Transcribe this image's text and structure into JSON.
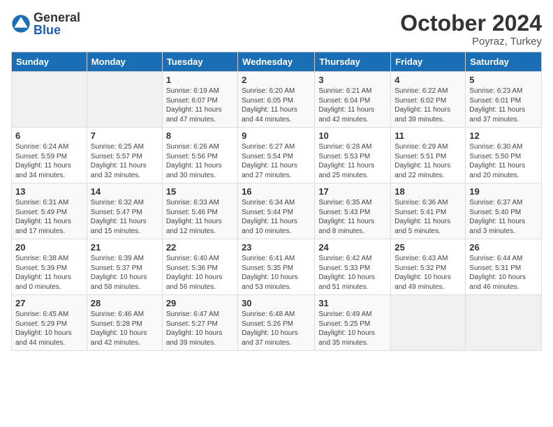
{
  "header": {
    "logo_general": "General",
    "logo_blue": "Blue",
    "month_title": "October 2024",
    "location": "Poyraz, Turkey"
  },
  "days_of_week": [
    "Sunday",
    "Monday",
    "Tuesday",
    "Wednesday",
    "Thursday",
    "Friday",
    "Saturday"
  ],
  "weeks": [
    [
      {
        "day": "",
        "info": ""
      },
      {
        "day": "",
        "info": ""
      },
      {
        "day": "1",
        "info": "Sunrise: 6:19 AM\nSunset: 6:07 PM\nDaylight: 11 hours and 47 minutes."
      },
      {
        "day": "2",
        "info": "Sunrise: 6:20 AM\nSunset: 6:05 PM\nDaylight: 11 hours and 44 minutes."
      },
      {
        "day": "3",
        "info": "Sunrise: 6:21 AM\nSunset: 6:04 PM\nDaylight: 11 hours and 42 minutes."
      },
      {
        "day": "4",
        "info": "Sunrise: 6:22 AM\nSunset: 6:02 PM\nDaylight: 11 hours and 39 minutes."
      },
      {
        "day": "5",
        "info": "Sunrise: 6:23 AM\nSunset: 6:01 PM\nDaylight: 11 hours and 37 minutes."
      }
    ],
    [
      {
        "day": "6",
        "info": "Sunrise: 6:24 AM\nSunset: 5:59 PM\nDaylight: 11 hours and 34 minutes."
      },
      {
        "day": "7",
        "info": "Sunrise: 6:25 AM\nSunset: 5:57 PM\nDaylight: 11 hours and 32 minutes."
      },
      {
        "day": "8",
        "info": "Sunrise: 6:26 AM\nSunset: 5:56 PM\nDaylight: 11 hours and 30 minutes."
      },
      {
        "day": "9",
        "info": "Sunrise: 6:27 AM\nSunset: 5:54 PM\nDaylight: 11 hours and 27 minutes."
      },
      {
        "day": "10",
        "info": "Sunrise: 6:28 AM\nSunset: 5:53 PM\nDaylight: 11 hours and 25 minutes."
      },
      {
        "day": "11",
        "info": "Sunrise: 6:29 AM\nSunset: 5:51 PM\nDaylight: 11 hours and 22 minutes."
      },
      {
        "day": "12",
        "info": "Sunrise: 6:30 AM\nSunset: 5:50 PM\nDaylight: 11 hours and 20 minutes."
      }
    ],
    [
      {
        "day": "13",
        "info": "Sunrise: 6:31 AM\nSunset: 5:49 PM\nDaylight: 11 hours and 17 minutes."
      },
      {
        "day": "14",
        "info": "Sunrise: 6:32 AM\nSunset: 5:47 PM\nDaylight: 11 hours and 15 minutes."
      },
      {
        "day": "15",
        "info": "Sunrise: 6:33 AM\nSunset: 5:46 PM\nDaylight: 11 hours and 12 minutes."
      },
      {
        "day": "16",
        "info": "Sunrise: 6:34 AM\nSunset: 5:44 PM\nDaylight: 11 hours and 10 minutes."
      },
      {
        "day": "17",
        "info": "Sunrise: 6:35 AM\nSunset: 5:43 PM\nDaylight: 11 hours and 8 minutes."
      },
      {
        "day": "18",
        "info": "Sunrise: 6:36 AM\nSunset: 5:41 PM\nDaylight: 11 hours and 5 minutes."
      },
      {
        "day": "19",
        "info": "Sunrise: 6:37 AM\nSunset: 5:40 PM\nDaylight: 11 hours and 3 minutes."
      }
    ],
    [
      {
        "day": "20",
        "info": "Sunrise: 6:38 AM\nSunset: 5:39 PM\nDaylight: 11 hours and 0 minutes."
      },
      {
        "day": "21",
        "info": "Sunrise: 6:39 AM\nSunset: 5:37 PM\nDaylight: 10 hours and 58 minutes."
      },
      {
        "day": "22",
        "info": "Sunrise: 6:40 AM\nSunset: 5:36 PM\nDaylight: 10 hours and 56 minutes."
      },
      {
        "day": "23",
        "info": "Sunrise: 6:41 AM\nSunset: 5:35 PM\nDaylight: 10 hours and 53 minutes."
      },
      {
        "day": "24",
        "info": "Sunrise: 6:42 AM\nSunset: 5:33 PM\nDaylight: 10 hours and 51 minutes."
      },
      {
        "day": "25",
        "info": "Sunrise: 6:43 AM\nSunset: 5:32 PM\nDaylight: 10 hours and 49 minutes."
      },
      {
        "day": "26",
        "info": "Sunrise: 6:44 AM\nSunset: 5:31 PM\nDaylight: 10 hours and 46 minutes."
      }
    ],
    [
      {
        "day": "27",
        "info": "Sunrise: 6:45 AM\nSunset: 5:29 PM\nDaylight: 10 hours and 44 minutes."
      },
      {
        "day": "28",
        "info": "Sunrise: 6:46 AM\nSunset: 5:28 PM\nDaylight: 10 hours and 42 minutes."
      },
      {
        "day": "29",
        "info": "Sunrise: 6:47 AM\nSunset: 5:27 PM\nDaylight: 10 hours and 39 minutes."
      },
      {
        "day": "30",
        "info": "Sunrise: 6:48 AM\nSunset: 5:26 PM\nDaylight: 10 hours and 37 minutes."
      },
      {
        "day": "31",
        "info": "Sunrise: 6:49 AM\nSunset: 5:25 PM\nDaylight: 10 hours and 35 minutes."
      },
      {
        "day": "",
        "info": ""
      },
      {
        "day": "",
        "info": ""
      }
    ]
  ]
}
